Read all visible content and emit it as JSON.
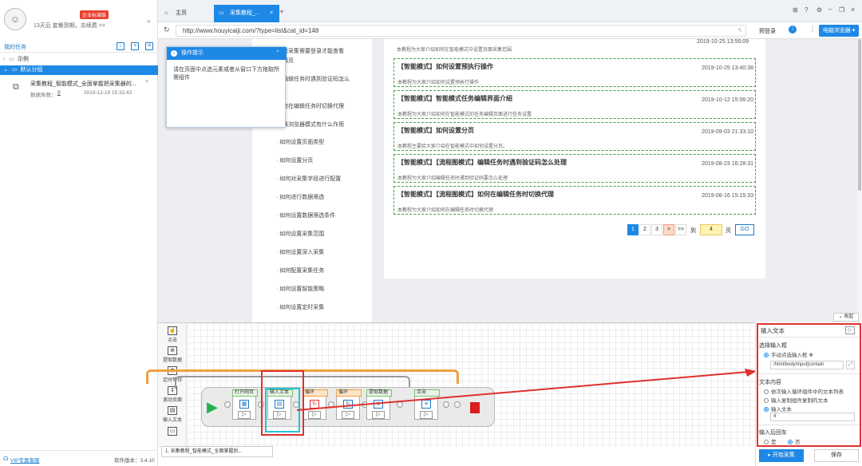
{
  "sidebar": {
    "enterprise_badge": "企业标准版",
    "expire_text": "13天后 套餐到期，去续费 >>",
    "my_tasks": "我的任务",
    "tree": [
      {
        "label": "示例"
      },
      {
        "label": "默认分组"
      }
    ],
    "task": {
      "name": "采集教程_智能模式_全面掌握把采集器的...",
      "count_label": "数据条数：",
      "count": "0",
      "time": "2019-12-19 15:32:42"
    },
    "vip_service": "VIP专属客服",
    "version": "软件版本：3.4.10"
  },
  "tabs": {
    "home": "主页",
    "active": "采集教程_..."
  },
  "address": {
    "url": "http://www.houyicaiji.com/?type=list&cat_id=148",
    "preview": "预登录",
    "browser_button": "电脑浏览器"
  },
  "page": {
    "menu": [
      {
        "label": "何采集需要登录才能查看"
      },
      {
        "label": "网页"
      },
      {
        "label": "编辑任务时遇到验证码怎么"
      },
      {
        "label": "何在编辑任务时切换代理"
      },
      {
        "label": "换浏览器模式有什么作用"
      },
      {
        "label": "如何设置页面类型"
      },
      {
        "label": "如何设置分页"
      },
      {
        "label": "如何对采集字段进行配置"
      },
      {
        "label": "如何进行数据筛选"
      },
      {
        "label": "如何设置数据筛选条件"
      },
      {
        "label": "如何设置采集范围"
      },
      {
        "label": "如何设置深入采集"
      },
      {
        "label": "如何配置采集任务"
      },
      {
        "label": "如何设置智能策略"
      },
      {
        "label": "如何设置定时采集"
      }
    ],
    "top_desc": "本教程为大家介绍如何在智能模式中设置页面采集范围",
    "top_date": "2019-10-25 13:56:09",
    "articles": [
      {
        "title": "【智能模式】如何设置预执行操作",
        "date": "2019-10-25 13:40:38",
        "desc": "本教程为大家介绍如何设置预执行操作"
      },
      {
        "title": "【智能模式】智能模式任务编辑界面介绍",
        "date": "2019-10-12 15:06:20",
        "desc": "本教程为大家介绍如何在智能模式的任务编辑页面进行任务设置"
      },
      {
        "title": "【智能模式】如何设置分页",
        "date": "2019-09-03 21:33:10",
        "desc": "本教程主要给大家介绍在智能模式中如何设置分页。"
      },
      {
        "title": "【智能模式】【流程图模式】编辑任务时遇到验证码怎么处理",
        "date": "2019-08-23 16:28:31",
        "desc": "本教程为大家介绍编辑任务时遇到验证码要怎么处理"
      },
      {
        "title": "【智能模式】【流程图模式】如何在编辑任务时切换代理",
        "date": "2019-08-16 15:15:33",
        "desc": "本教程为大家介绍如何在编辑任务时切换代理"
      }
    ],
    "pagination": {
      "pages": [
        "1",
        "2",
        "3"
      ],
      "next": ">",
      "last": ">>",
      "goto_label": "到",
      "goto_value": "4",
      "page_label": "页",
      "go": "GO"
    }
  },
  "tooltip": {
    "title": "操作提示",
    "body": "请在页面中点选元素或者从窗口下方拖取所需组件"
  },
  "collapse": "收起",
  "workflow": {
    "tools": [
      {
        "label": "点击"
      },
      {
        "label": "提取数据"
      },
      {
        "label": "定时等待"
      },
      {
        "label": "滚动页面"
      },
      {
        "label": "输入文本"
      }
    ],
    "nodes": [
      {
        "label": "打开网页"
      },
      {
        "label": "输入文本"
      },
      {
        "label": "循环"
      },
      {
        "label": "循环"
      },
      {
        "label": "提取数据"
      },
      {
        "label": "点击"
      }
    ],
    "task_tab": "1. 采集教程_智能模式_全面掌握后..."
  },
  "props": {
    "title": "输入文本",
    "select_input_label": "选择输入框",
    "manual_select": "手动点选输入框",
    "xpath": "/html/body/input[contain",
    "text_content_label": "文本内容",
    "options": [
      "依次输入循环组件中的文本列表",
      "输入复制组件复制的文本",
      "输入文本"
    ],
    "input_value": "4",
    "enter_label": "输入后回车",
    "yes": "是",
    "no": "否"
  },
  "buttons": {
    "start": "开始采集",
    "save": "保存"
  }
}
